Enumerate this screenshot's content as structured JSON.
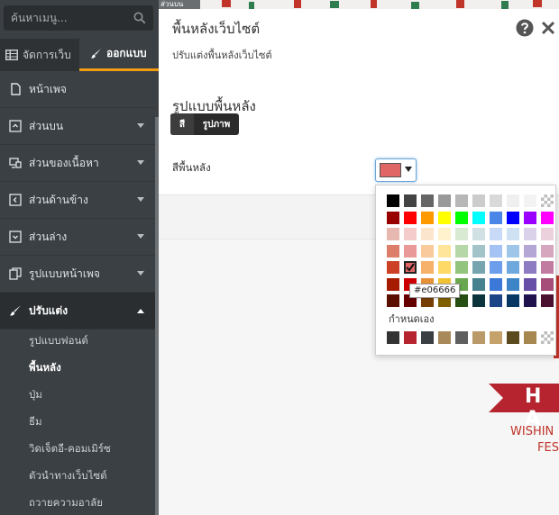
{
  "sidebar": {
    "search_placeholder": "ค้นหาเมนู...",
    "tabs": {
      "manage": "จัดการเว็บ",
      "design": "ออกแบบ"
    },
    "menu": [
      {
        "label": "หน้าเพจ",
        "icon": "page-icon",
        "has_chevron": false
      },
      {
        "label": "ส่วนบน",
        "icon": "header-icon",
        "has_chevron": true
      },
      {
        "label": "ส่วนของเนื้อหา",
        "icon": "content-icon",
        "has_chevron": true
      },
      {
        "label": "ส่วนด้านข้าง",
        "icon": "side-icon",
        "has_chevron": true
      },
      {
        "label": "ส่วนล่าง",
        "icon": "footer-icon",
        "has_chevron": true
      },
      {
        "label": "รูปแบบหน้าเพจ",
        "icon": "layout-icon",
        "has_chevron": true
      }
    ],
    "active_menu": {
      "label": "ปรับแต่ง",
      "icon": "brush-icon"
    },
    "sub_items": [
      "รูปแบบฟอนต์",
      "พื้นหลัง",
      "ปุ่ม",
      "ธีม",
      "วิดเจ็ตอี-คอมเมิร์ซ",
      "ตัวนำทางเว็บไซต์",
      "ถวายความอาลัย"
    ],
    "active_sub_item": "พื้นหลัง"
  },
  "panel": {
    "title": "พื้นหลังเว็บไซต์",
    "subtitle": "ปรับแต่งพื้นหลังเว็บไซต์",
    "section_title": "รูปแบบพื้นหลัง",
    "toggle_color": "สี",
    "toggle_image": "รูปภาพ",
    "bg_color_label": "สีพื้นหลัง",
    "current_color": "#e06666"
  },
  "color_picker": {
    "rows": [
      [
        "#000000",
        "#434343",
        "#666666",
        "#999999",
        "#b7b7b7",
        "#cccccc",
        "#d9d9d9",
        "#efefef",
        "#f3f3f3",
        "checker"
      ],
      [
        "#980000",
        "#ff0000",
        "#ff9900",
        "#ffff00",
        "#00ff00",
        "#00ffff",
        "#4a86e8",
        "#0000ff",
        "#9900ff",
        "#ff00ff"
      ],
      [
        "#e6b8af",
        "#f4cccc",
        "#fce5cd",
        "#fff2cc",
        "#d9ead3",
        "#d0e0e3",
        "#c9daf8",
        "#cfe2f3",
        "#d9d2e9",
        "#ead1dc"
      ],
      [
        "#dd7e6b",
        "#ea9999",
        "#f9cb9c",
        "#ffe599",
        "#b6d7a8",
        "#a2c4c9",
        "#a4c2f4",
        "#9fc5e8",
        "#b4a7d6",
        "#d5a6bd"
      ],
      [
        "#cc4125",
        "#e06666",
        "#f6b26b",
        "#ffd966",
        "#93c47d",
        "#76a5af",
        "#6d9eeb",
        "#6fa8dc",
        "#8e7cc3",
        "#c27ba0"
      ],
      [
        "#a61c00",
        "#cc0000",
        "#e69138",
        "#f1c232",
        "#6aa84f",
        "#45818e",
        "#3c78d8",
        "#3d85c6",
        "#674ea7",
        "#a64d79"
      ],
      [
        "#5b0f00",
        "#660000",
        "#783f04",
        "#7f6000",
        "#274e13",
        "#0c343d",
        "#1c4587",
        "#073763",
        "#20124d",
        "#4c1130"
      ]
    ],
    "selected_row": 4,
    "selected_col": 1,
    "hex_tooltip": "#e06666",
    "custom_label": "กำหนดเอง",
    "custom_colors": [
      "#333333",
      "#b5242f",
      "#3a3f44",
      "#a8895a",
      "#5f5f5f",
      "#b99a68",
      "#c6a26b",
      "#5a4a1e",
      "#a5874f",
      "checker"
    ]
  },
  "preview": {
    "banner_text": "H A",
    "wishing_text": "WISHIN",
    "fes_text": "FES",
    "top_dropdown": "ส่วนบน"
  },
  "colors": {
    "sidebar_bg": "#3b4044",
    "accent": "#f39c12",
    "banner_red": "#b5242f"
  }
}
